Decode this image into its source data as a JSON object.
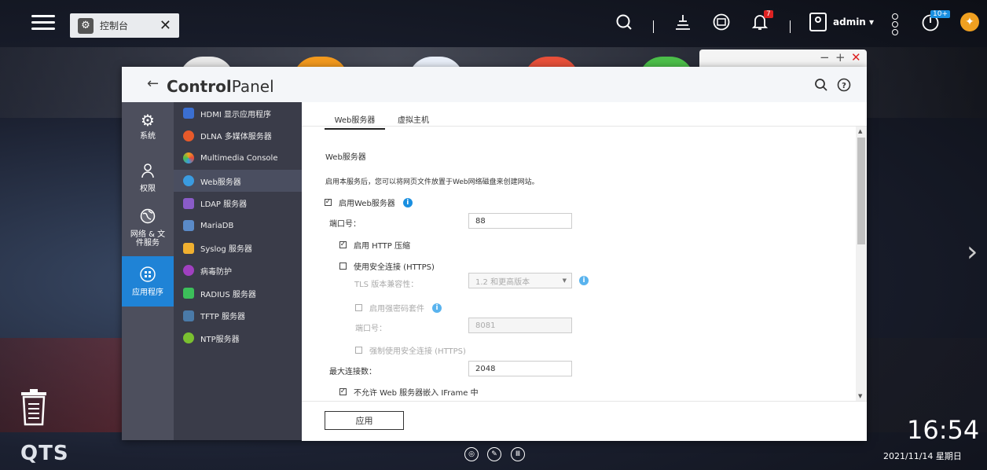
{
  "taskbar": {
    "tab_label": "控制台",
    "notification_badge": "7",
    "update_badge": "10+",
    "user": "admin ▾"
  },
  "window": {
    "title_part1": "Control",
    "title_part2": "Panel"
  },
  "categories": [
    {
      "label": "系统"
    },
    {
      "label": "权限"
    },
    {
      "label": "网络 & 文件服务"
    },
    {
      "label": "应用程序"
    }
  ],
  "apps": [
    {
      "label": "HDMI 显示应用程序",
      "color": "#3b6fd1"
    },
    {
      "label": "DLNA 多媒体服务器",
      "color": "#e85a2a"
    },
    {
      "label": "Multimedia Console",
      "color": "#f0a020"
    },
    {
      "label": "Web服务器",
      "color": "#3a9be0"
    },
    {
      "label": "LDAP 服务器",
      "color": "#8a5cc8"
    },
    {
      "label": "MariaDB",
      "color": "#5a8ac8"
    },
    {
      "label": "Syslog 服务器",
      "color": "#f0b030"
    },
    {
      "label": "病毒防护",
      "color": "#a040c0"
    },
    {
      "label": "RADIUS 服务器",
      "color": "#3cbf5a"
    },
    {
      "label": "TFTP 服务器",
      "color": "#4a7aa8"
    },
    {
      "label": "NTP服务器",
      "color": "#7ac030"
    }
  ],
  "tabs": {
    "web": "Web服务器",
    "vhost": "虚拟主机"
  },
  "form": {
    "section_title": "Web服务器",
    "description": "启用本服务后，您可以将网页文件放置于Web网络磁盘来创建网站。",
    "enable_web": "启用Web服务器",
    "port_label": "端口号：",
    "port_value": "88",
    "http_compression": "启用 HTTP 压缩",
    "https": "使用安全连接 (HTTPS)",
    "tls_label": "TLS 版本兼容性：",
    "tls_value": "1.2 和更高版本",
    "cipher": "启用强密码套件",
    "https_port_label": "端口号：",
    "https_port_value": "8081",
    "force_https": "强制使用安全连接 (HTTPS)",
    "max_conn_label": "最大连接数：",
    "max_conn_value": "2048",
    "iframe": "不允许 Web 服务器嵌入 IFrame 中"
  },
  "footer": {
    "apply": "应用"
  },
  "desktop": {
    "brand": "QTS",
    "time": "16:54",
    "date": "2021/11/14 星期日"
  }
}
